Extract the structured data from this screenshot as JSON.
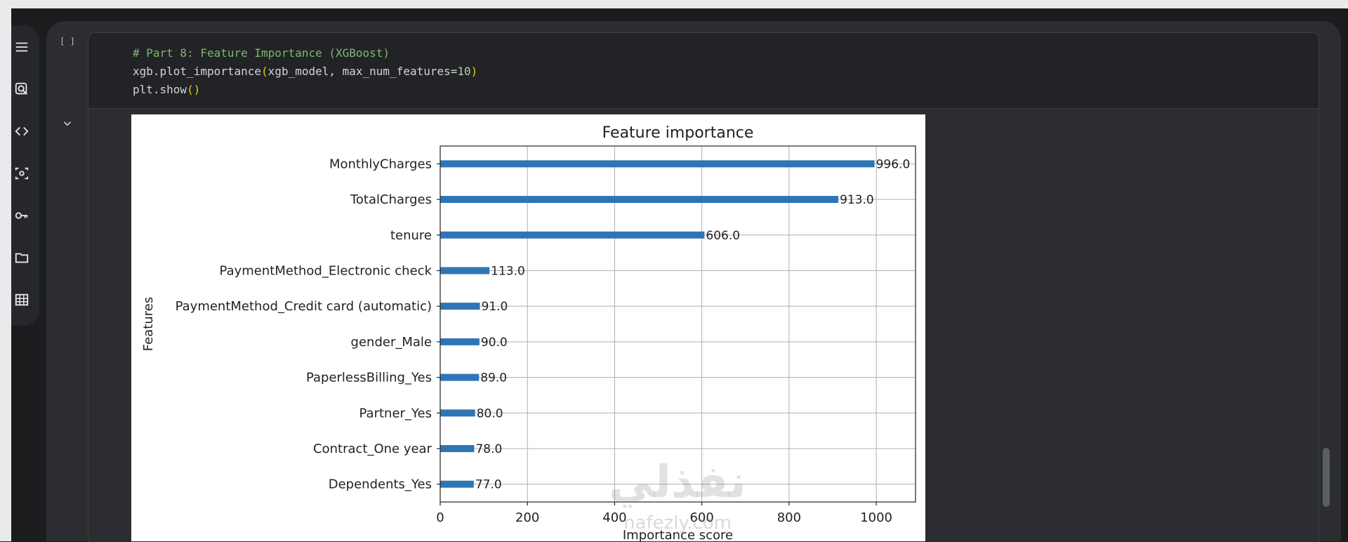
{
  "sidebar": {
    "items": [
      {
        "icon": "menu-icon"
      },
      {
        "icon": "search-icon"
      },
      {
        "icon": "code-icon"
      },
      {
        "icon": "variables-icon"
      },
      {
        "icon": "key-icon"
      },
      {
        "icon": "folder-icon"
      },
      {
        "icon": "table-icon"
      }
    ]
  },
  "cell": {
    "run_label": "[ ]",
    "code": {
      "line1": "# Part 8: Feature Importance (XGBoost)",
      "line2_a": "xgb.plot_importance",
      "line2_paren_open": "(",
      "line2_b": "xgb_model, max_num_features=",
      "line2_num": "10",
      "line2_paren_close": ")",
      "line3_a": "plt.show",
      "line3_parens": "()"
    }
  },
  "watermark": {
    "text": "نفذلي",
    "url": "nafezly.com"
  },
  "colors": {
    "bar": "#2e75b6",
    "grid": "#b0b0b0",
    "comment": "#7fb66f",
    "paren": "#f1c40f"
  },
  "chart_data": {
    "type": "bar",
    "orientation": "horizontal",
    "title": "Feature importance",
    "xlabel": "Importance score",
    "ylabel": "Features",
    "categories": [
      "MonthlyCharges",
      "TotalCharges",
      "tenure",
      "PaymentMethod_Electronic check",
      "PaymentMethod_Credit card (automatic)",
      "gender_Male",
      "PaperlessBilling_Yes",
      "Partner_Yes",
      "Contract_One year",
      "Dependents_Yes"
    ],
    "values": [
      996.0,
      913.0,
      606.0,
      113.0,
      91.0,
      90.0,
      89.0,
      80.0,
      78.0,
      77.0
    ],
    "value_labels": [
      "996.0",
      "913.0",
      "606.0",
      "113.0",
      "91.0",
      "90.0",
      "89.0",
      "80.0",
      "78.0",
      "77.0"
    ],
    "xlim": [
      0,
      1090
    ],
    "xticks": [
      0,
      200,
      400,
      600,
      800,
      1000
    ],
    "xtick_labels": [
      "0",
      "200",
      "400",
      "600",
      "800",
      "1000"
    ],
    "grid": true
  }
}
